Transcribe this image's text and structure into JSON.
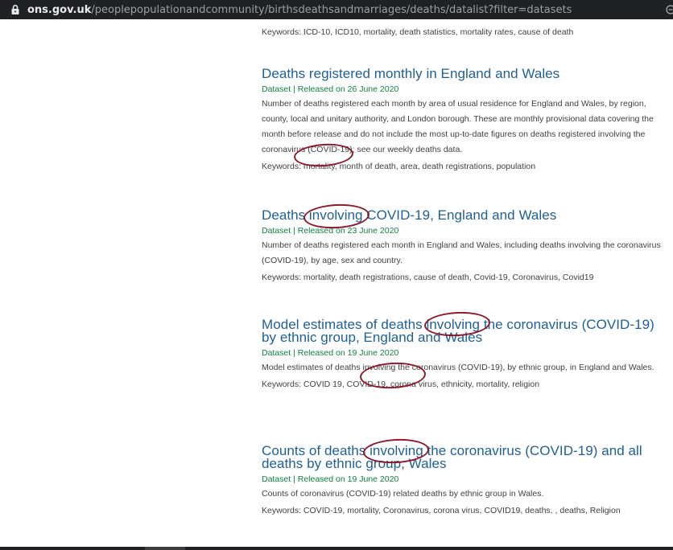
{
  "addressbar": {
    "domain": "ons.gov.uk",
    "path": "/peoplepopulationandcommunity/birthsdeathsandmarriages/deaths/datalist?filter=datasets"
  },
  "top_keywords": "Keywords: ICD-10, ICD10, mortality, death statistics, mortality rates, cause of death",
  "results": [
    {
      "title": "Deaths registered monthly in England and Wales",
      "meta": "Dataset | Released on 26 June 2020",
      "description": "Number of deaths registered each month by area of usual residence for England and Wales, by region, county, local and unitary authority, and London borough. These are monthly provisional data covering the month before release and do not include the most up-to-date figures on deaths registered involving the coronavirus (COVID-19); see our weekly deaths data.",
      "keywords": "Keywords: mortality, month of death, area, death registrations, population"
    },
    {
      "title": "Deaths involving COVID-19, England and Wales",
      "meta": "Dataset | Released on 23 June 2020",
      "description": "Number of deaths registered each month in England and Wales, including deaths involving the coronavirus (COVID-19), by age, sex and country.",
      "keywords": "Keywords: mortality, death registrations, cause of death, Covid-19, Coronavirus, Covid19"
    },
    {
      "title": "Model estimates of deaths involving the coronavirus (COVID-19) by ethnic group, England and Wales",
      "meta": "Dataset | Released on 19 June 2020",
      "description": "Model estimates of deaths involving the coronavirus (COVID-19), by ethnic group, in England and Wales.",
      "keywords": "Keywords: COVID 19, COVID-19, corona virus, ethnicity, mortality, religion"
    },
    {
      "title": "Counts of deaths involving the coronavirus (COVID-19) and all deaths by ethnic group, Wales",
      "meta": "Dataset | Released on 19 June 2020",
      "description": "Counts of coronavirus (COVID-19) related deaths by ethnic group in Wales.",
      "keywords": "Keywords: COVID-19, mortality, Coronavirus, corona virus, COVID19, deaths, , deaths, Religion"
    }
  ],
  "colors": {
    "link": "#206095",
    "meta": "#0f8243",
    "text": "#414042",
    "annotation": "#8b1a2b"
  }
}
